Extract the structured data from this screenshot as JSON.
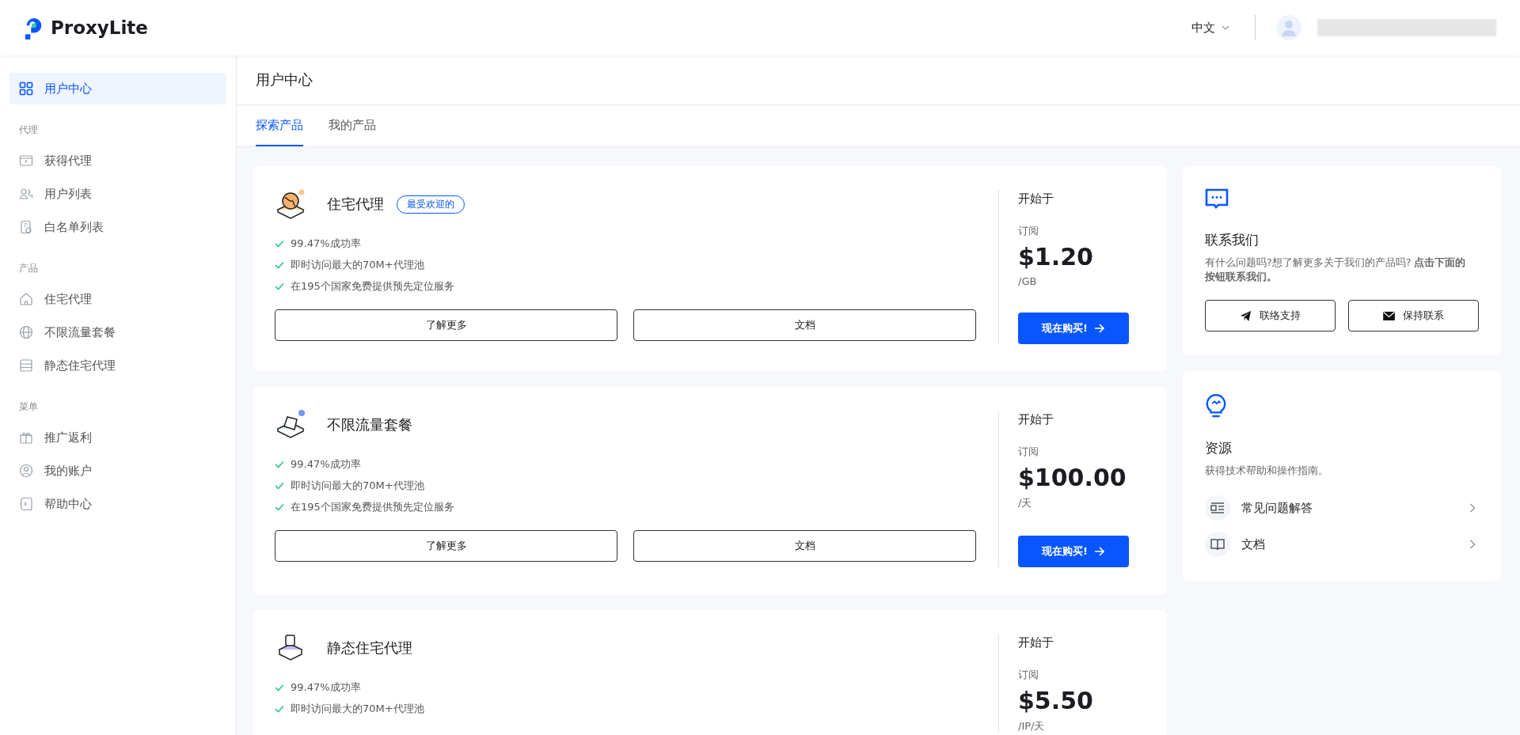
{
  "brand": {
    "name": "ProxyLite"
  },
  "header": {
    "language": "中文"
  },
  "sidebar": {
    "top_item": {
      "label": "用户中心",
      "selected": true
    },
    "sections": [
      {
        "label": "代理",
        "items": [
          {
            "label": "获得代理",
            "selected": false
          },
          {
            "label": "用户列表",
            "selected": false
          },
          {
            "label": "白名单列表",
            "selected": false
          }
        ]
      },
      {
        "label": "产品",
        "items": [
          {
            "label": "住宅代理",
            "selected": false
          },
          {
            "label": "不限流量套餐",
            "selected": false
          },
          {
            "label": "静态住宅代理",
            "selected": false
          }
        ]
      },
      {
        "label": "菜单",
        "items": [
          {
            "label": "推广返利",
            "selected": false
          },
          {
            "label": "我的账户",
            "selected": false
          },
          {
            "label": "帮助中心",
            "selected": false
          }
        ]
      }
    ]
  },
  "page": {
    "title": "用户中心"
  },
  "tabs": [
    {
      "label": "探索产品",
      "selected": true
    },
    {
      "label": "我的产品",
      "selected": false
    }
  ],
  "products": [
    {
      "title": "住宅代理",
      "badge": "最受欢迎的",
      "features": [
        "99.47%成功率",
        "即时访问最大的70M+代理池",
        "在195个国家免费提供预先定位服务"
      ],
      "buttons": [
        "了解更多",
        "文档"
      ],
      "price_label": "开始于",
      "plan": "订阅",
      "price": "$1.20",
      "unit": "/GB",
      "buy": "现在购买!"
    },
    {
      "title": "不限流量套餐",
      "features": [
        "99.47%成功率",
        "即时访问最大的70M+代理池",
        "在195个国家免费提供预先定位服务"
      ],
      "buttons": [
        "了解更多",
        "文档"
      ],
      "price_label": "开始于",
      "plan": "订阅",
      "price": "$100.00",
      "unit": "/天",
      "buy": "现在购买!"
    },
    {
      "title": "静态住宅代理",
      "features": [
        "99.47%成功率",
        "即时访问最大的70M+代理池"
      ],
      "price_label": "开始于",
      "plan": "订阅",
      "price": "$5.50",
      "unit": "/IP/天"
    }
  ],
  "contact": {
    "title": "联系我们",
    "text": "有什么问题吗?想了解更多关于我们的产品吗? **点击下面的按钮联系我们。**",
    "buttons": [
      "联络支持",
      "保持联系"
    ]
  },
  "resources": {
    "title": "资源",
    "subtitle": "获得技术帮助和操作指南。",
    "links": [
      "常见问题解答",
      "文档"
    ]
  }
}
